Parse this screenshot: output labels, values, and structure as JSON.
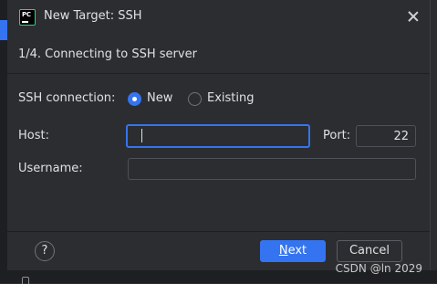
{
  "dialog": {
    "title": "New Target: SSH",
    "app_icon_text": "PC",
    "step": "1/4. Connecting to SSH server"
  },
  "form": {
    "ssh_connection_label": "SSH connection:",
    "options": [
      {
        "label": "New",
        "selected": true
      },
      {
        "label": "Existing",
        "selected": false
      }
    ],
    "host_label": "Host:",
    "host_value": "",
    "port_label": "Port:",
    "port_value": "22",
    "username_label": "Username:",
    "username_value": ""
  },
  "footer": {
    "help_symbol": "?",
    "next_mnemonic": "N",
    "next_rest": "ext",
    "cancel_label": "Cancel"
  },
  "watermark": "CSDN @ln 2029",
  "colors": {
    "accent": "#3574f0",
    "background": "#2b2d30",
    "text": "#dfe1e5"
  },
  "icons": {
    "app": "pycharm-logo-icon",
    "close": "close-icon",
    "help": "help-icon"
  }
}
